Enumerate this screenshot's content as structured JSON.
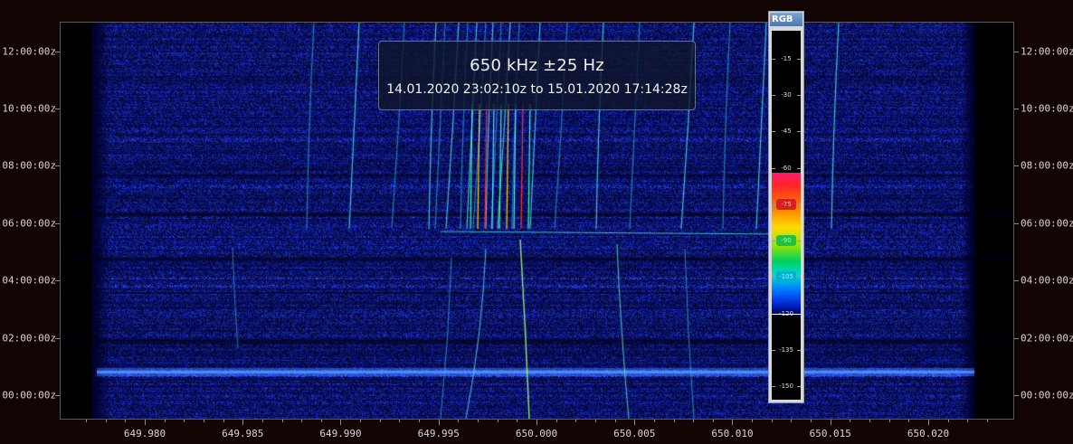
{
  "title": {
    "main": "650 kHz ±25 Hz",
    "range": "14.01.2020 23:02:10z to 15.01.2020 17:14:28z"
  },
  "time_axis": {
    "labels": [
      "12:00:00z",
      "10:00:00z",
      "08:00:00z",
      "06:00:00z",
      "04:00:00z",
      "02:00:00z",
      "00:00:00z"
    ],
    "hours": [
      12,
      10,
      8,
      6,
      4,
      2,
      0
    ]
  },
  "freq_axis": {
    "labels": [
      "649.980",
      "649.985",
      "649.990",
      "649.995",
      "650.000",
      "650.005",
      "650.010",
      "650.015",
      "650.020"
    ],
    "values_khz": [
      649.98,
      649.985,
      649.99,
      649.995,
      650.0,
      650.005,
      650.01,
      650.015,
      650.02
    ]
  },
  "color_scale": {
    "header": "RGB",
    "labels": [
      "-15",
      "-30",
      "-45",
      "-60",
      "-75",
      "-90",
      "-105",
      "-120",
      "-135",
      "-150"
    ],
    "values_db": [
      -15,
      -30,
      -45,
      -60,
      -75,
      -90,
      -105,
      -120,
      -135,
      -150
    ],
    "gradient_top_db": -62,
    "gradient_bottom_db": -121,
    "pointer_db": -120,
    "pill_colors": [
      "#d42020",
      "#e0a000",
      "#20c040",
      "#00b0d0"
    ],
    "pill_db": [
      -75,
      -90,
      -90,
      -105
    ]
  },
  "colors": {
    "background": "#130404",
    "plot_bg": "#000000",
    "noise_blue": "#0b2bb0"
  }
}
